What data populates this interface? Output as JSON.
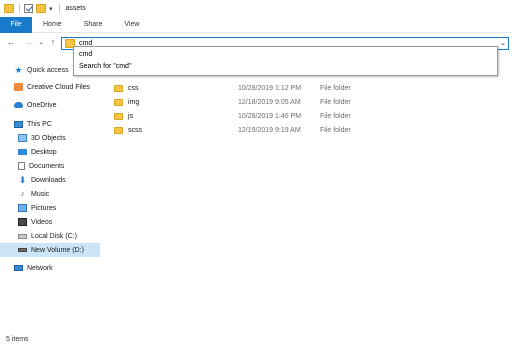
{
  "window": {
    "title": "assets"
  },
  "ribbon": {
    "tabs": [
      "File",
      "Home",
      "Share",
      "View"
    ]
  },
  "nav": {
    "back": "←",
    "forward": "→",
    "recent": "⌄",
    "up": "↑"
  },
  "address": {
    "value": "cmd",
    "dropdown": "⌄"
  },
  "suggestions": [
    "cmd",
    "Search for \"cmd\""
  ],
  "sidebar": {
    "items": [
      {
        "label": "Quick access",
        "icon": "star-icon"
      },
      {
        "label": "Creative Cloud Files",
        "icon": "creative-cloud-icon"
      },
      {
        "label": "OneDrive",
        "icon": "cloud-icon"
      },
      {
        "label": "This PC",
        "icon": "computer-icon"
      },
      {
        "label": "3D Objects",
        "icon": "cube-icon"
      },
      {
        "label": "Desktop",
        "icon": "desktop-icon"
      },
      {
        "label": "Documents",
        "icon": "document-icon"
      },
      {
        "label": "Downloads",
        "icon": "download-icon"
      },
      {
        "label": "Music",
        "icon": "music-icon"
      },
      {
        "label": "Pictures",
        "icon": "pictures-icon"
      },
      {
        "label": "Videos",
        "icon": "video-icon"
      },
      {
        "label": "Local Disk (C:)",
        "icon": "disk-icon"
      },
      {
        "label": "New Volume (D:)",
        "icon": "drive-icon"
      },
      {
        "label": "Network",
        "icon": "network-icon"
      }
    ]
  },
  "files": [
    {
      "name": "css",
      "date": "10/28/2019 1:12 PM",
      "type": "File folder"
    },
    {
      "name": "img",
      "date": "12/18/2019 9:05 AM",
      "type": "File folder"
    },
    {
      "name": "js",
      "date": "10/28/2019 1:46 PM",
      "type": "File folder"
    },
    {
      "name": "scss",
      "date": "12/19/2019 9:19 AM",
      "type": "File folder"
    }
  ],
  "status": {
    "items": "5 items"
  },
  "colors": {
    "accent": "#1979ca",
    "selected": "#cce4f7",
    "folder": "#f5c542"
  }
}
